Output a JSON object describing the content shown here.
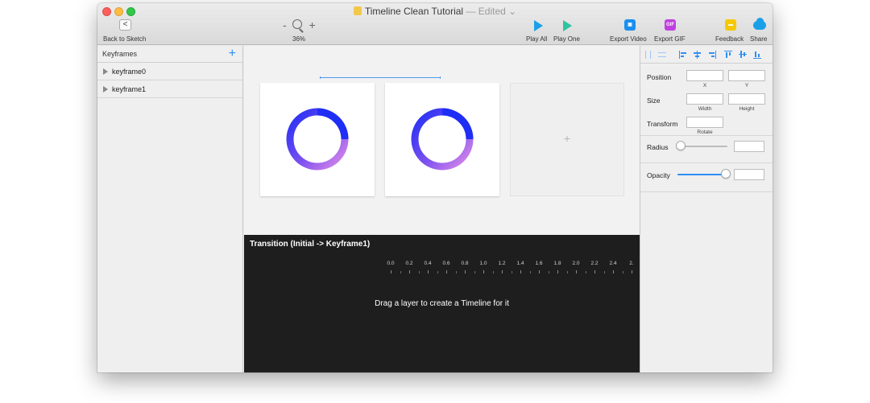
{
  "window": {
    "title": "Timeline Clean Tutorial",
    "edited_suffix": "— Edited ⌄"
  },
  "toolbar": {
    "back_label": "Back to Sketch",
    "back_glyph": "<",
    "zoom_minus": "-",
    "zoom_plus": "+",
    "zoom_level": "36%",
    "play_all_label": "Play All",
    "play_one_label": "Play One",
    "export_video_label": "Export Video",
    "export_gif_label": "Export GIF",
    "gif_badge": "GIF",
    "feedback_label": "Feedback",
    "share_label": "Share",
    "colors": {
      "play": "#1aa0e8",
      "play_one": "#2ec4a0",
      "video": "#1a8ff0",
      "gif": "#c040e0",
      "feedback": "#f5c800",
      "share": "#1aa0e8"
    }
  },
  "sidebar": {
    "title": "Keyframes",
    "add_glyph": "+",
    "items": [
      {
        "label": "keyframe0"
      },
      {
        "label": "keyframe1"
      }
    ]
  },
  "canvas": {
    "add_frame_glyph": "+",
    "ring_colors": {
      "start": "#1f2ef5",
      "mid": "#7a50f0",
      "end": "#e08ce8"
    },
    "frames": [
      {
        "arc_progress": 0.72
      },
      {
        "arc_progress": 0.72
      }
    ]
  },
  "timeline": {
    "title": "Transition (Initial -> Keyframe1)",
    "ruler_labels": [
      "0.0",
      "0.2",
      "0.4",
      "0.6",
      "0.8",
      "1.0",
      "1.2",
      "1.4",
      "1.6",
      "1.8",
      "2.0",
      "2.2",
      "2.4",
      "2."
    ],
    "empty_message": "Drag a layer to create a Timeline for it"
  },
  "inspector": {
    "position_label": "Position",
    "x_caption": "X",
    "y_caption": "Y",
    "size_label": "Size",
    "width_caption": "Width",
    "height_caption": "Height",
    "transform_label": "Transform",
    "rotate_caption": "Rotate",
    "radius_label": "Radius",
    "radius_value_fraction": 0.0,
    "opacity_label": "Opacity",
    "opacity_value_fraction": 1.0,
    "accent_color": "#2f8ff5"
  }
}
